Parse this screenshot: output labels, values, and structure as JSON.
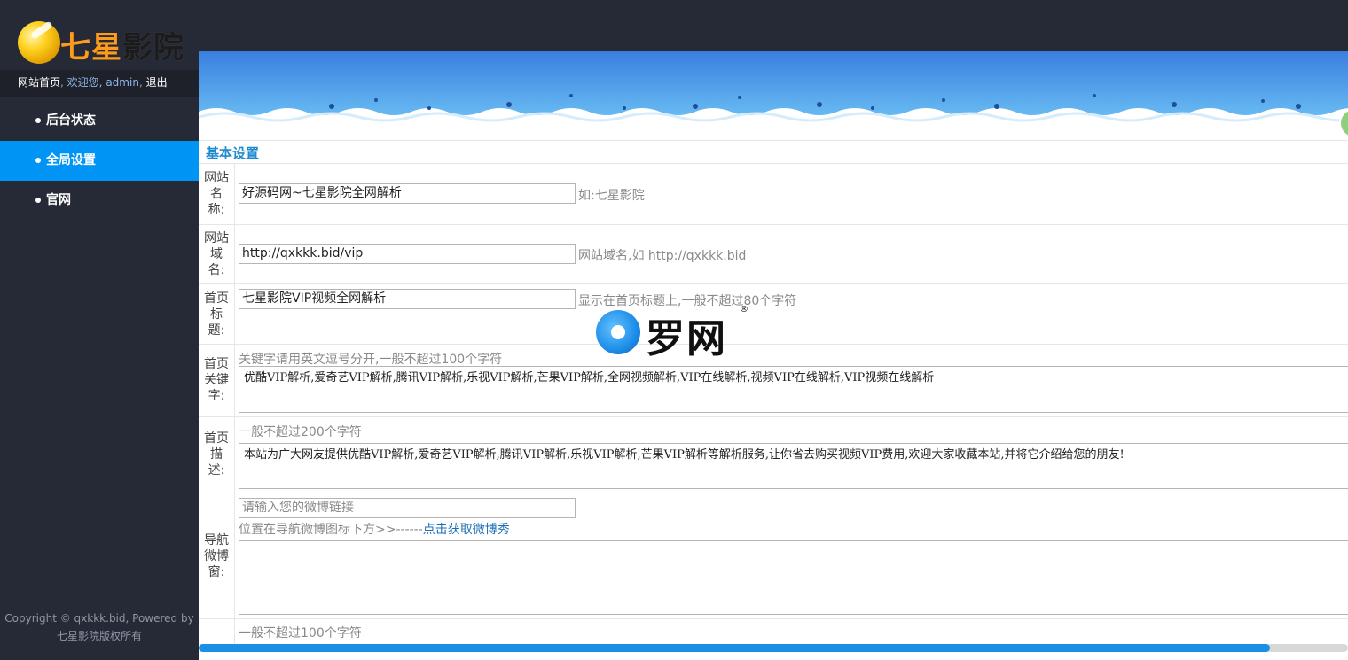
{
  "brand": {
    "logo_text_1": "七星",
    "logo_text_2": "影院"
  },
  "userbar": {
    "home": "网站首页",
    "sep1": ",",
    "welcome": "欢迎您,",
    "user": "admin",
    "sep2": ",",
    "logout": "退出"
  },
  "nav": {
    "items": [
      {
        "label": "后台状态"
      },
      {
        "label": "全局设置"
      },
      {
        "label": "官网"
      }
    ]
  },
  "footer": {
    "line1": "Copyright © qxkkk.bid, Powered by",
    "line2": "七星影院版权所有"
  },
  "section": {
    "title": "基本设置"
  },
  "form": {
    "site_name": {
      "label_1": "网站",
      "label_2": "名",
      "label_3": "称:",
      "value": "好源码网~七星影院全网解析",
      "hint": "如:七星影院"
    },
    "site_domain": {
      "label_1": "网站",
      "label_2": "域",
      "label_3": "名:",
      "value": "http://qxkkk.bid/vip",
      "hint": "网站域名,如 http://qxkkk.bid"
    },
    "home_title": {
      "label_1": "首页",
      "label_2": "标",
      "label_3": "题:",
      "value": "七星影院VIP视频全网解析",
      "hint": "显示在首页标题上,一般不超过80个字符"
    },
    "home_keywords": {
      "label_1": "首页",
      "label_2": "关键",
      "label_3": "字:",
      "hint": "关键字请用英文逗号分开,一般不超过100个字符",
      "value": "优酷VIP解析,爱奇艺VIP解析,腾讯VIP解析,乐视VIP解析,芒果VIP解析,全网视频解析,VIP在线解析,视频VIP在线解析,VIP视频在线解析"
    },
    "home_description": {
      "label_1": "首页",
      "label_2": "描",
      "label_3": "述:",
      "hint": "一般不超过200个字符",
      "value": "本站为广大网友提供优酷VIP解析,爱奇艺VIP解析,腾讯VIP解析,乐视VIP解析,芒果VIP解析等解析服务,让你省去购买视频VIP费用,欢迎大家收藏本站,并将它介绍给您的朋友!"
    },
    "nav_weibo": {
      "label_1": "导航",
      "label_2": "微博",
      "label_3": "窗:",
      "placeholder": "请输入您的微博链接",
      "hint_prefix": "位置在导航微博图标下方>>------",
      "hint_link": "点击获取微博秀"
    },
    "bottom_hint": "一般不超过100个字符"
  },
  "watermark": {
    "text": "罗网",
    "mark": "®"
  },
  "colors": {
    "sidebar_bg": "#262a36",
    "active_nav": "#0095f5",
    "section_title": "#1e8bd0",
    "scroll_thumb": "#1a8fe6"
  }
}
